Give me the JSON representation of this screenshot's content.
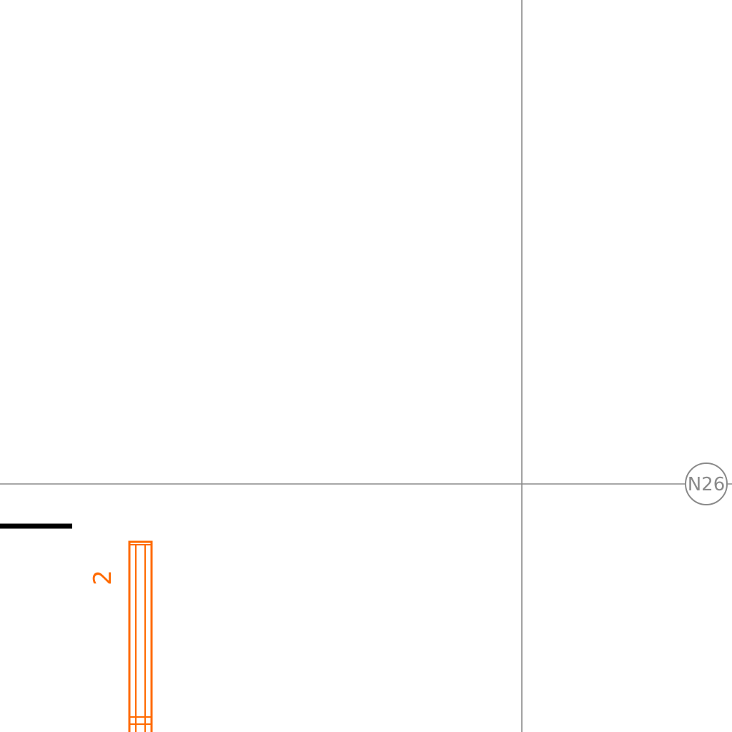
{
  "colors": {
    "background": "#ffffff",
    "grid": "#8a8a8a",
    "element": "#ff6a00",
    "wall": "#000000"
  },
  "grid": {
    "bubble_label": "N26"
  },
  "element": {
    "label": "2"
  }
}
